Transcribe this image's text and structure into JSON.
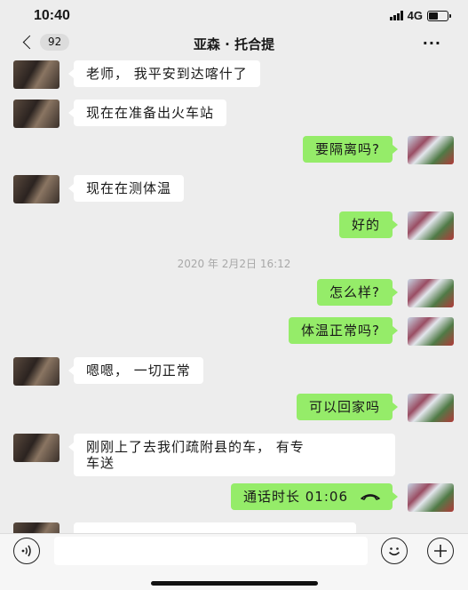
{
  "status_bar": {
    "time": "10:40",
    "network": "4G",
    "battery_level": 0.55
  },
  "nav": {
    "unread_count": "92",
    "title": "亚森 · 托合提",
    "more_label": "···"
  },
  "messages": [
    {
      "side": "in",
      "text": "老师， 我平安到达喀什了"
    },
    {
      "side": "in",
      "text": "现在在准备出火车站"
    },
    {
      "side": "out",
      "text": "要隔离吗?"
    },
    {
      "side": "in",
      "text": "现在在测体温"
    },
    {
      "side": "out",
      "text": "好的"
    },
    {
      "side": "out",
      "text": "怎么样?"
    },
    {
      "side": "out",
      "text": "体温正常吗?"
    },
    {
      "side": "in",
      "text": "嗯嗯， 一切正常"
    },
    {
      "side": "out",
      "text": "可以回家吗"
    },
    {
      "side": "in",
      "text": "刚刚上了去我们疏附县的车， 有专\n车送"
    },
    {
      "side": "out",
      "text": "通话时长 01:06"
    }
  ],
  "timestamp": "2020 年 2月2日 16:12",
  "input": {
    "value": "",
    "placeholder": ""
  },
  "icons": {
    "voice": "voice-icon",
    "emoji": "emoji-icon",
    "plus": "plus-icon",
    "call": "phone-hangup-icon"
  },
  "colors": {
    "outgoing_bubble": "#95ec69",
    "incoming_bubble": "#ffffff",
    "background": "#ededed"
  }
}
